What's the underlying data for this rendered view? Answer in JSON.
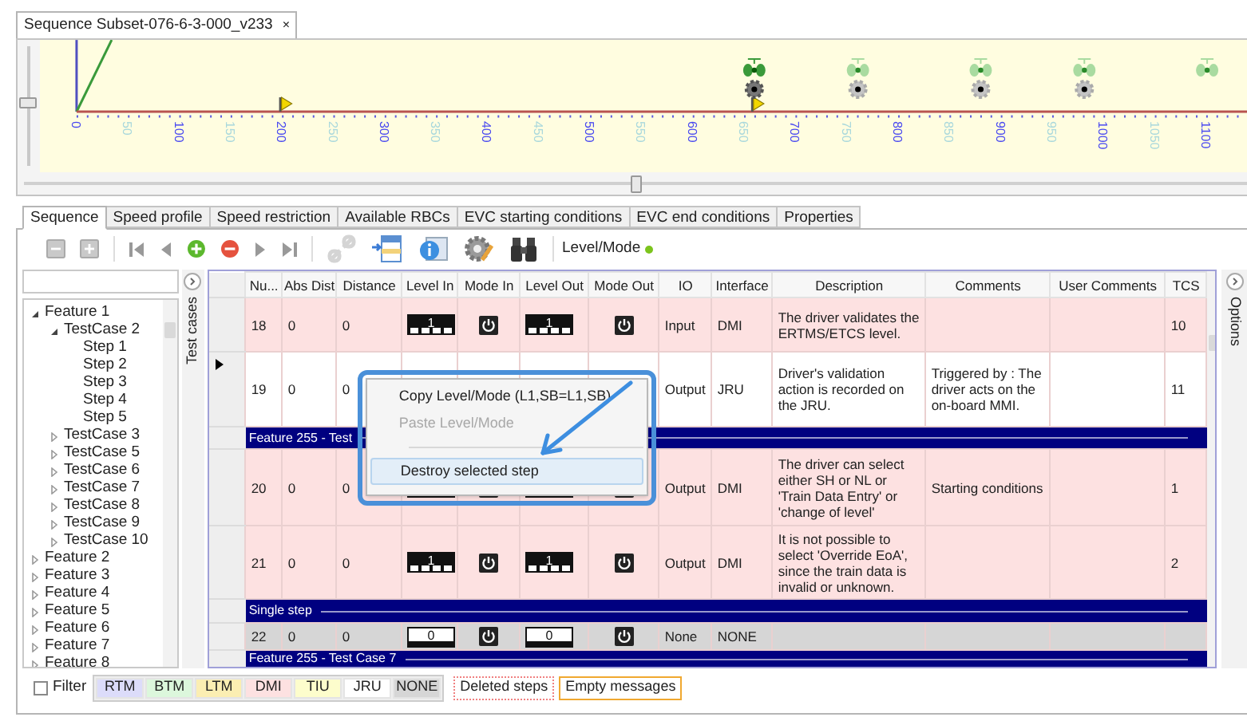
{
  "document_tab": {
    "title": "Sequence Subset-076-6-3-000_v233",
    "close": "×"
  },
  "timeline": {
    "scroll_slider": {
      "level": 0.5
    },
    "axis_labels": [
      {
        "text": "0",
        "major": true
      },
      {
        "text": "50",
        "major": false
      },
      {
        "text": "100",
        "major": true
      },
      {
        "text": "150",
        "major": false
      },
      {
        "text": "200",
        "major": true
      },
      {
        "text": "250",
        "major": false
      },
      {
        "text": "300",
        "major": true
      },
      {
        "text": "350",
        "major": false
      },
      {
        "text": "400",
        "major": true
      },
      {
        "text": "450",
        "major": false
      },
      {
        "text": "500",
        "major": true
      },
      {
        "text": "550",
        "major": false
      },
      {
        "text": "600",
        "major": true
      },
      {
        "text": "650",
        "major": false
      },
      {
        "text": "700",
        "major": true
      },
      {
        "text": "750",
        "major": false
      },
      {
        "text": "800",
        "major": true
      },
      {
        "text": "850",
        "major": false
      },
      {
        "text": "900",
        "major": true
      },
      {
        "text": "950",
        "major": false
      },
      {
        "text": "1000",
        "major": true
      },
      {
        "text": "1050",
        "major": false
      },
      {
        "text": "1100",
        "major": true
      }
    ],
    "balises": [
      {
        "active": true,
        "paired": true
      },
      {
        "active": false,
        "paired": true
      },
      {
        "active": false,
        "paired": true
      },
      {
        "active": false,
        "paired": true
      },
      {
        "active": false,
        "paired": false
      }
    ]
  },
  "tabs": [
    {
      "label": "Sequence",
      "selected": true
    },
    {
      "label": "Speed profile",
      "selected": false
    },
    {
      "label": "Speed restriction",
      "selected": false
    },
    {
      "label": "Available RBCs",
      "selected": false
    },
    {
      "label": "EVC starting conditions",
      "selected": false
    },
    {
      "label": "EVC end conditions",
      "selected": false
    },
    {
      "label": "Properties",
      "selected": false
    }
  ],
  "toolbar": {
    "level_mode_label": "Level/Mode"
  },
  "tree": [
    {
      "label": "Feature 1",
      "expanded": true,
      "children": [
        {
          "label": "TestCase 2",
          "expanded": true,
          "children": [
            {
              "label": "Step 1"
            },
            {
              "label": "Step 2"
            },
            {
              "label": "Step 3"
            },
            {
              "label": "Step 4"
            },
            {
              "label": "Step 5"
            }
          ]
        },
        {
          "label": "TestCase 3",
          "expanded": false
        },
        {
          "label": "TestCase 5",
          "expanded": false
        },
        {
          "label": "TestCase 6",
          "expanded": false
        },
        {
          "label": "TestCase 7",
          "expanded": false
        },
        {
          "label": "TestCase 8",
          "expanded": false
        },
        {
          "label": "TestCase 9",
          "expanded": false
        },
        {
          "label": "TestCase 10",
          "expanded": false
        }
      ]
    },
    {
      "label": "Feature 2",
      "expanded": false
    },
    {
      "label": "Feature 3",
      "expanded": false
    },
    {
      "label": "Feature 4",
      "expanded": false
    },
    {
      "label": "Feature 5",
      "expanded": false
    },
    {
      "label": "Feature 6",
      "expanded": false
    },
    {
      "label": "Feature 7",
      "expanded": false
    },
    {
      "label": "Feature 8",
      "expanded": false
    }
  ],
  "test_cases_label": "Test cases",
  "options_label": "Options",
  "table": {
    "columns": [
      "Nu...",
      "Abs Dist",
      "Distance",
      "Level In",
      "Mode In",
      "Level Out",
      "Mode Out",
      "IO",
      "Interface",
      "Description",
      "Comments",
      "User Comments",
      "TCS"
    ],
    "rows": [
      {
        "kind": "step",
        "nu": "18",
        "abs_dist": "0",
        "distance": "0",
        "level_in": {
          "kind": "blocks",
          "digit": "1"
        },
        "level_out": {
          "kind": "blocks",
          "digit": "1"
        },
        "io": "Input",
        "interface": "DMI",
        "description": "The driver validates the ERTMS/ETCS level.",
        "tcs": "10",
        "color": "#fde1e1",
        "selected": false
      },
      {
        "kind": "step",
        "nu": "19",
        "abs_dist": "0",
        "distance": "0",
        "io": "Output",
        "interface": "JRU",
        "description": "Driver's validation action is recorded on the JRU.",
        "comments": "Triggered by : The driver acts on the on-board MMI.",
        "tcs": "11",
        "color": "#ffffff",
        "selected": true
      },
      {
        "kind": "group",
        "label": "Feature 255 - Test"
      },
      {
        "kind": "step",
        "nu": "20",
        "abs_dist": "0",
        "distance": "0",
        "level_in": {
          "kind": "blocks"
        },
        "level_out": {
          "kind": "blocks"
        },
        "io": "Output",
        "interface": "DMI",
        "description": "The driver can select either SH or NL or 'Train Data Entry' or 'change of level'",
        "comments": "Starting conditions",
        "tcs": "1",
        "color": "#fde1e1",
        "selected": false
      },
      {
        "kind": "step",
        "nu": "21",
        "abs_dist": "0",
        "distance": "0",
        "level_in": {
          "kind": "blocks",
          "digit": "1"
        },
        "level_out": {
          "kind": "blocks",
          "digit": "1"
        },
        "io": "Output",
        "interface": "DMI",
        "description": "It is not possible to select 'Override EoA', since the train data is invalid or unknown.",
        "tcs": "2",
        "color": "#fde1e1",
        "selected": false
      },
      {
        "kind": "group",
        "label": "Single step"
      },
      {
        "kind": "step",
        "nu": "22",
        "abs_dist": "0",
        "distance": "0",
        "level_in": {
          "kind": "bar",
          "digit": "0"
        },
        "level_out": {
          "kind": "bar",
          "digit": "0"
        },
        "io": "None",
        "interface": "NONE",
        "color": "#d6d6d6",
        "selected": false
      },
      {
        "kind": "group",
        "label": "Feature 255 - Test Case 7"
      }
    ]
  },
  "context_menu": {
    "items": [
      {
        "label": "Copy Level/Mode (L1,SB=L1,SB)",
        "disabled": false,
        "highlighted": false
      },
      {
        "label": "Paste Level/Mode",
        "disabled": true,
        "highlighted": false
      },
      {
        "label": "Destroy selected step",
        "disabled": false,
        "highlighted": true
      }
    ]
  },
  "legend": {
    "filter": {
      "label": "Filter",
      "checked": false
    },
    "items": [
      {
        "label": "RTM",
        "color": "#dcdcfa"
      },
      {
        "label": "BTM",
        "color": "#dcf7dc"
      },
      {
        "label": "LTM",
        "color": "#fbeeb2"
      },
      {
        "label": "DMI",
        "color": "#fde1e1"
      },
      {
        "label": "TIU",
        "color": "#fdfdcc"
      },
      {
        "label": "JRU",
        "color": "#ffffff"
      },
      {
        "label": "NONE",
        "color": "#d6d6d6"
      }
    ],
    "deleted_label": "Deleted steps",
    "empty_label": "Empty messages"
  }
}
